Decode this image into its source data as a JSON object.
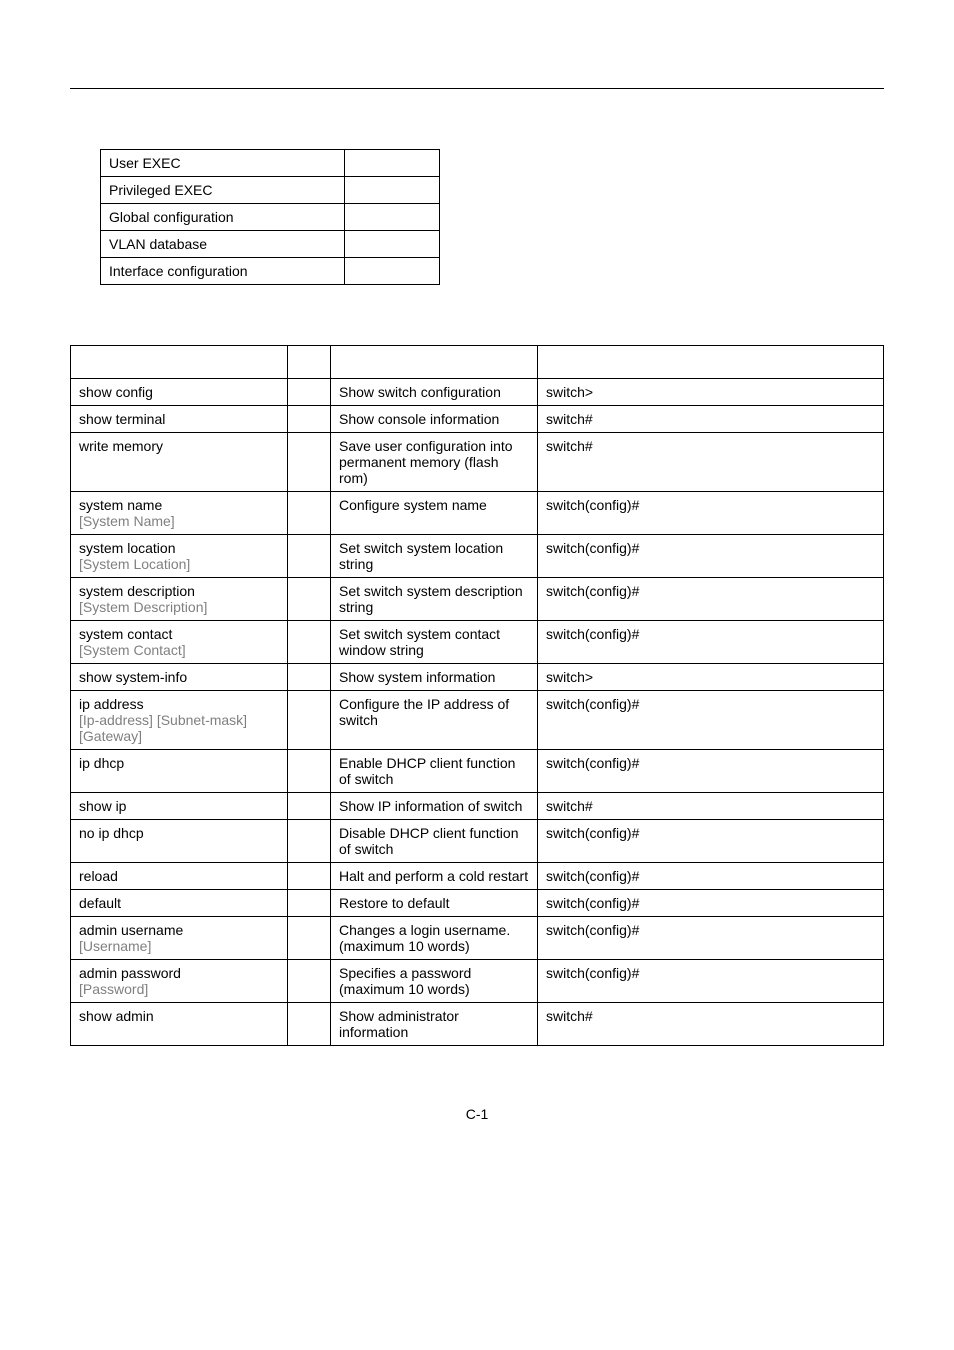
{
  "modes": [
    {
      "label": "User EXEC"
    },
    {
      "label": "Privileged EXEC"
    },
    {
      "label": "Global configuration"
    },
    {
      "label": "VLAN database"
    },
    {
      "label": "Interface configuration"
    }
  ],
  "commands": [
    {
      "cmd": "show config",
      "param": "",
      "desc": "Show switch configuration",
      "def": "switch>"
    },
    {
      "cmd": "show terminal",
      "param": "",
      "desc": "Show console information",
      "def": "switch#"
    },
    {
      "cmd": "write memory",
      "param": "",
      "desc": "Save user configuration into permanent memory (flash rom)",
      "def": "switch#"
    },
    {
      "cmd": "system name",
      "param": "[System Name]",
      "desc": "Configure system name",
      "def": "switch(config)#"
    },
    {
      "cmd": "system location",
      "param": "[System Location]",
      "desc": "Set switch system location string",
      "def": "switch(config)#"
    },
    {
      "cmd": "system description",
      "param": "[System Description]",
      "desc": "Set switch system description string",
      "def": "switch(config)#"
    },
    {
      "cmd": "system contact",
      "param": "[System Contact]",
      "desc": "Set switch system contact window string",
      "def": "switch(config)#"
    },
    {
      "cmd": "show system-info",
      "param": "",
      "desc": "Show system information",
      "def": "switch>"
    },
    {
      "cmd": "ip address",
      "param": "[Ip-address] [Subnet-mask] [Gateway]",
      "desc": "Configure the IP address of switch",
      "def": "switch(config)#"
    },
    {
      "cmd": "ip dhcp",
      "param": "",
      "desc": "Enable DHCP client function of switch",
      "def": "switch(config)#"
    },
    {
      "cmd": "show ip",
      "param": "",
      "desc": "Show IP information of switch",
      "def": "switch#"
    },
    {
      "cmd": "no ip dhcp",
      "param": "",
      "desc": "Disable DHCP client function of switch",
      "def": "switch(config)#"
    },
    {
      "cmd": "reload",
      "param": "",
      "desc": "Halt and perform a cold restart",
      "def": "switch(config)#"
    },
    {
      "cmd": "default",
      "param": "",
      "desc": "Restore to default",
      "def": "switch(config)#"
    },
    {
      "cmd": "admin username",
      "param": "[Username]",
      "desc": "Changes a login username. (maximum 10 words)",
      "def": "switch(config)#"
    },
    {
      "cmd": "admin password",
      "param": "[Password]",
      "desc": "Specifies a password (maximum 10 words)",
      "def": "switch(config)#"
    },
    {
      "cmd": "show admin",
      "param": "",
      "desc": "Show administrator information",
      "def": "switch#"
    }
  ],
  "footer": "C-1"
}
